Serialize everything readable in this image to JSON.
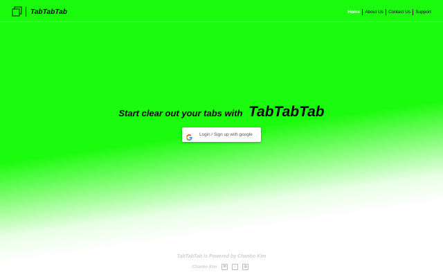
{
  "app": {
    "brand_name": "TabTabTab"
  },
  "nav": {
    "items": [
      {
        "label": "Home",
        "active": true
      },
      {
        "label": "About Us",
        "active": false
      },
      {
        "label": "Contact Us",
        "active": false
      },
      {
        "label": "Support",
        "active": false
      }
    ]
  },
  "hero": {
    "lead": "Start clear out your tabs with",
    "brand": "TabTabTab",
    "login_label": "Login / Sign up with google"
  },
  "footer": {
    "powered_by": "TabTabTab is Powered by Chanho Kim",
    "author": "Chanho Kim",
    "social": [
      {
        "icon": "linkedin-icon",
        "glyph": "in"
      },
      {
        "icon": "github-icon",
        "glyph": "⌂"
      },
      {
        "icon": "instagram-icon",
        "glyph": "◎"
      }
    ]
  },
  "colors": {
    "hero_green": "#1bfb0d",
    "active_nav": "#ffffff",
    "footer_text": "#cfcfcf"
  }
}
